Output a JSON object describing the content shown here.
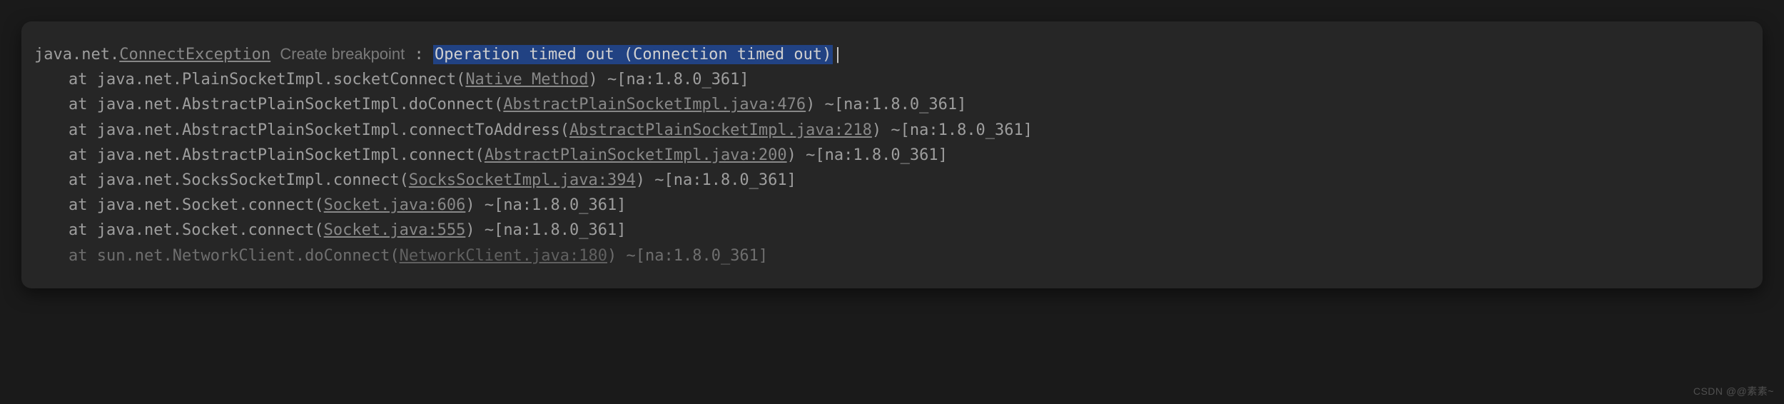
{
  "header": {
    "package": "java.net.",
    "exception": "ConnectException",
    "breakpoint_hint": "Create breakpoint",
    "colon": " : ",
    "message": "Operation timed out (Connection timed out)"
  },
  "stack": [
    {
      "prefix": "at ",
      "method": "java.net.PlainSocketImpl.socketConnect(",
      "source": "Native Method",
      "close": ")",
      "suffix": " ~[na:1.8.0_361]"
    },
    {
      "prefix": "at ",
      "method": "java.net.AbstractPlainSocketImpl.doConnect(",
      "source": "AbstractPlainSocketImpl.java:476",
      "close": ")",
      "suffix": " ~[na:1.8.0_361]"
    },
    {
      "prefix": "at ",
      "method": "java.net.AbstractPlainSocketImpl.connectToAddress(",
      "source": "AbstractPlainSocketImpl.java:218",
      "close": ")",
      "suffix": " ~[na:1.8.0_361]"
    },
    {
      "prefix": "at ",
      "method": "java.net.AbstractPlainSocketImpl.connect(",
      "source": "AbstractPlainSocketImpl.java:200",
      "close": ")",
      "suffix": " ~[na:1.8.0_361]"
    },
    {
      "prefix": "at ",
      "method": "java.net.SocksSocketImpl.connect(",
      "source": "SocksSocketImpl.java:394",
      "close": ")",
      "suffix": " ~[na:1.8.0_361]"
    },
    {
      "prefix": "at ",
      "method": "java.net.Socket.connect(",
      "source": "Socket.java:606",
      "close": ")",
      "suffix": " ~[na:1.8.0_361]"
    },
    {
      "prefix": "at ",
      "method": "java.net.Socket.connect(",
      "source": "Socket.java:555",
      "close": ")",
      "suffix": " ~[na:1.8.0_361]"
    },
    {
      "prefix": "at ",
      "method": "sun.net.NetworkClient.doConnect(",
      "source": "NetworkClient.java:180",
      "close": ")",
      "suffix": " ~[na:1.8.0_361]"
    }
  ],
  "watermark": "CSDN @@素素~"
}
